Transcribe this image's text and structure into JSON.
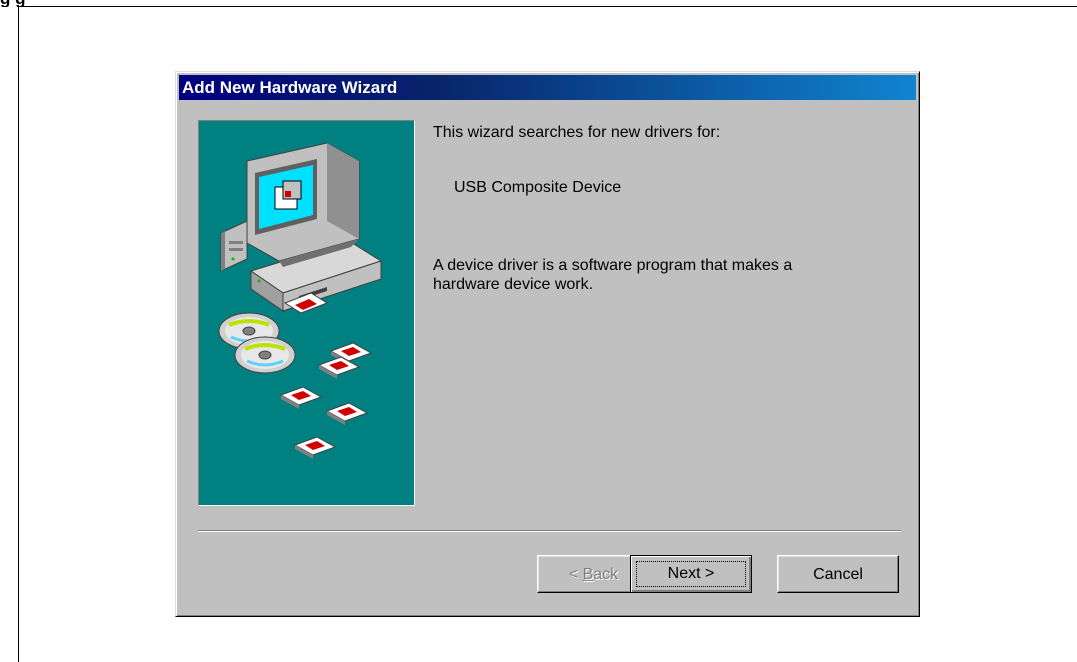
{
  "window": {
    "title": "Add New Hardware Wizard"
  },
  "content": {
    "intro": "This wizard searches for new drivers for:",
    "device_name": "USB Composite Device",
    "description": "A device driver is a software program that makes a hardware device work."
  },
  "buttons": {
    "back_prefix": "< ",
    "back_mnemonic": "B",
    "back_rest": "ack",
    "next": "Next >",
    "cancel": "Cancel"
  },
  "colors": {
    "titlebar_start": "#000080",
    "titlebar_end": "#1084d0",
    "dialog_face": "#c0c0c0",
    "art_background": "#008080"
  },
  "illustration": {
    "icons": [
      "computer-icon",
      "monitor-icon",
      "cd-disc-icon",
      "floppy-disk-icon"
    ]
  }
}
